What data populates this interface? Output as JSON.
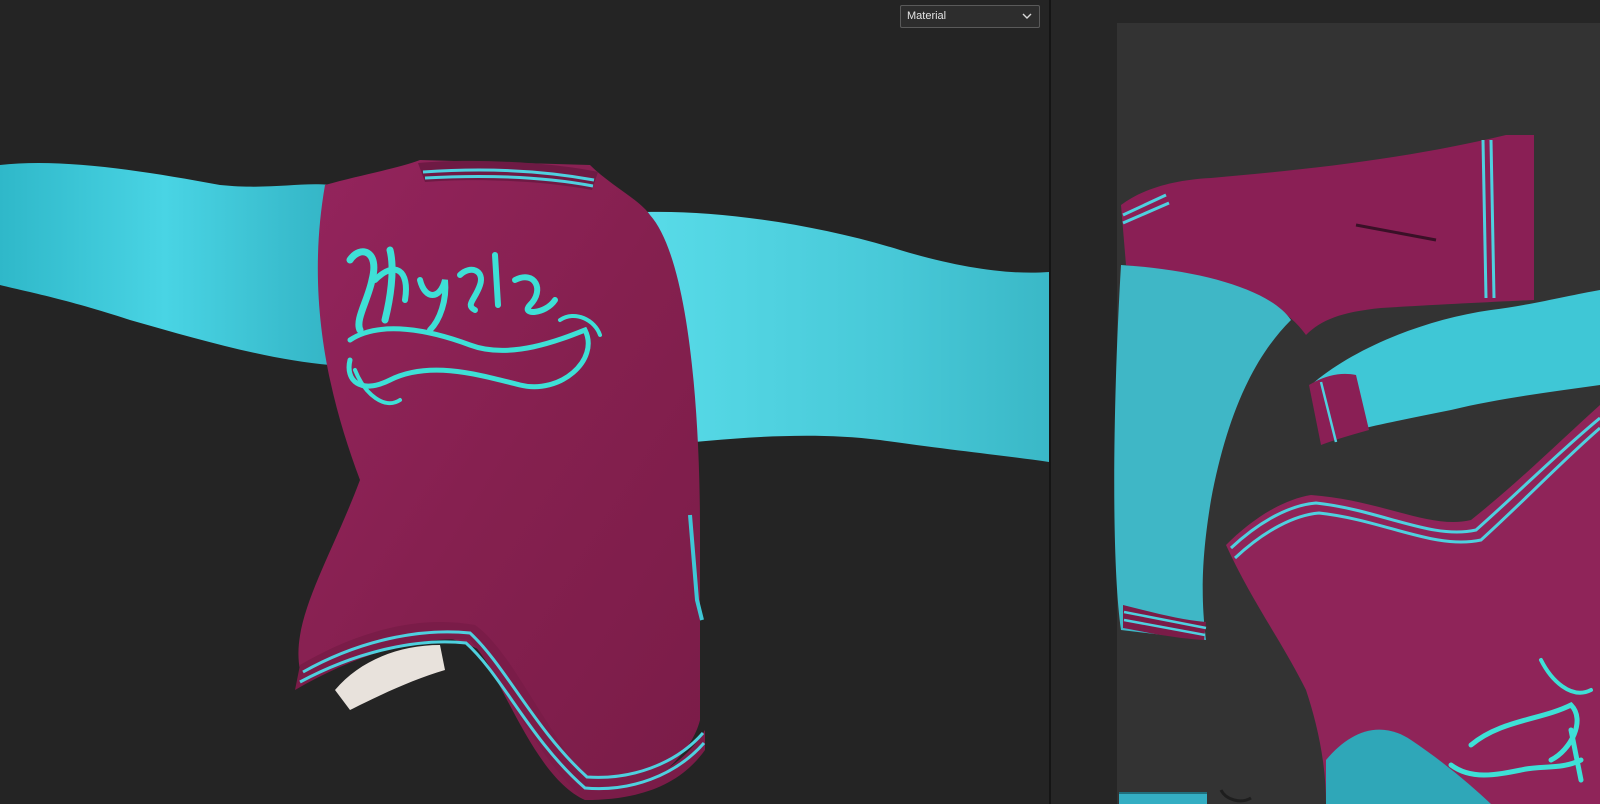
{
  "viewport": {
    "display_mode_dropdown": {
      "selected": "Material",
      "icon": "chevron-down-icon"
    }
  },
  "colors": {
    "jacket_body": "#8a1f55",
    "jacket_sleeves": "#3fd3e0",
    "stripe": "#46c6d6",
    "background": "#232323",
    "uv_canvas": "#333333"
  }
}
